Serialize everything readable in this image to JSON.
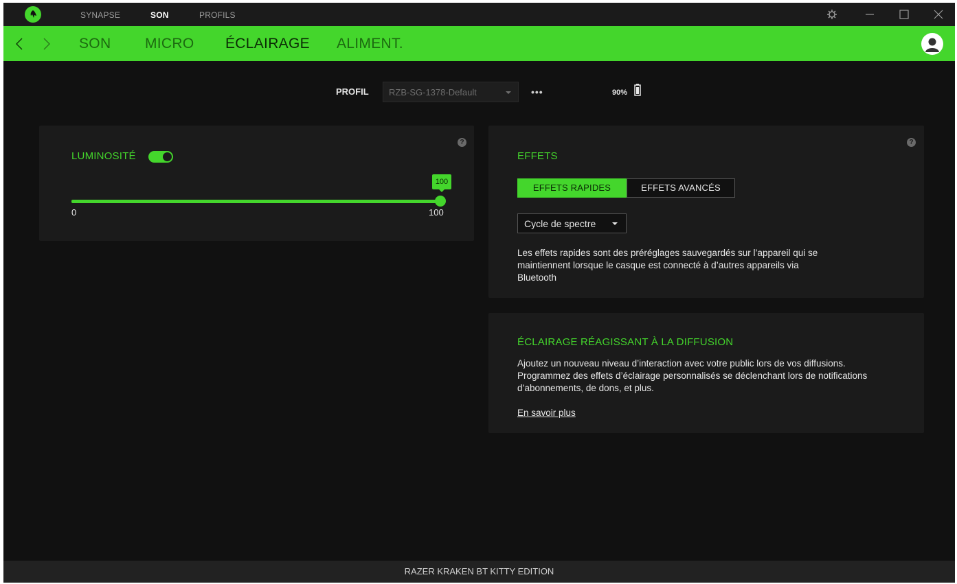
{
  "topbar": {
    "tabs": [
      {
        "label": "SYNAPSE",
        "active": false
      },
      {
        "label": "SON",
        "active": true
      },
      {
        "label": "PROFILS",
        "active": false
      }
    ]
  },
  "nav": {
    "tabs": [
      {
        "label": "SON",
        "active": false
      },
      {
        "label": "MICRO",
        "active": false
      },
      {
        "label": "ÉCLAIRAGE",
        "active": true
      },
      {
        "label": "ALIMENT.",
        "active": false
      }
    ]
  },
  "profile": {
    "label": "PROFIL",
    "selected": "RZB-SG-1378-Default",
    "more": "•••",
    "battery": "90%"
  },
  "brightness": {
    "label": "LUMINOSITÉ",
    "enabled": true,
    "value": "100",
    "min": "0",
    "max": "100",
    "help": "?"
  },
  "effects": {
    "title": "EFFETS",
    "help": "?",
    "tabs": [
      "EFFETS RAPIDES",
      "EFFETS AVANCÉS"
    ],
    "active_tab": "EFFETS RAPIDES",
    "selected_effect": "Cycle de spectre",
    "description": "Les effets rapides sont des préréglages sauvegardés sur l’appareil qui se maintiennent lorsque le casque est connecté à d’autres appareils via Bluetooth"
  },
  "streaming": {
    "title": "ÉCLAIRAGE RÉAGISSANT À LA DIFFUSION",
    "description": "Ajoutez un nouveau niveau d’interaction avec votre public lors de vos diffusions. Programmez des effets d’éclairage personnalisés se déclenchant lors de notifications d’abonnements, de dons, et plus.",
    "link": "En savoir plus"
  },
  "footer": {
    "device": "RAZER KRAKEN BT KITTY EDITION"
  },
  "colors": {
    "accent": "#44d62c",
    "background": "#111111",
    "panel": "#1b1b1b"
  },
  "icons": [
    "razer-logo-icon",
    "settings-icon",
    "minimize-icon",
    "maximize-icon",
    "close-icon",
    "back-arrow-icon",
    "forward-arrow-icon",
    "user-avatar-icon",
    "battery-icon",
    "help-icon"
  ]
}
